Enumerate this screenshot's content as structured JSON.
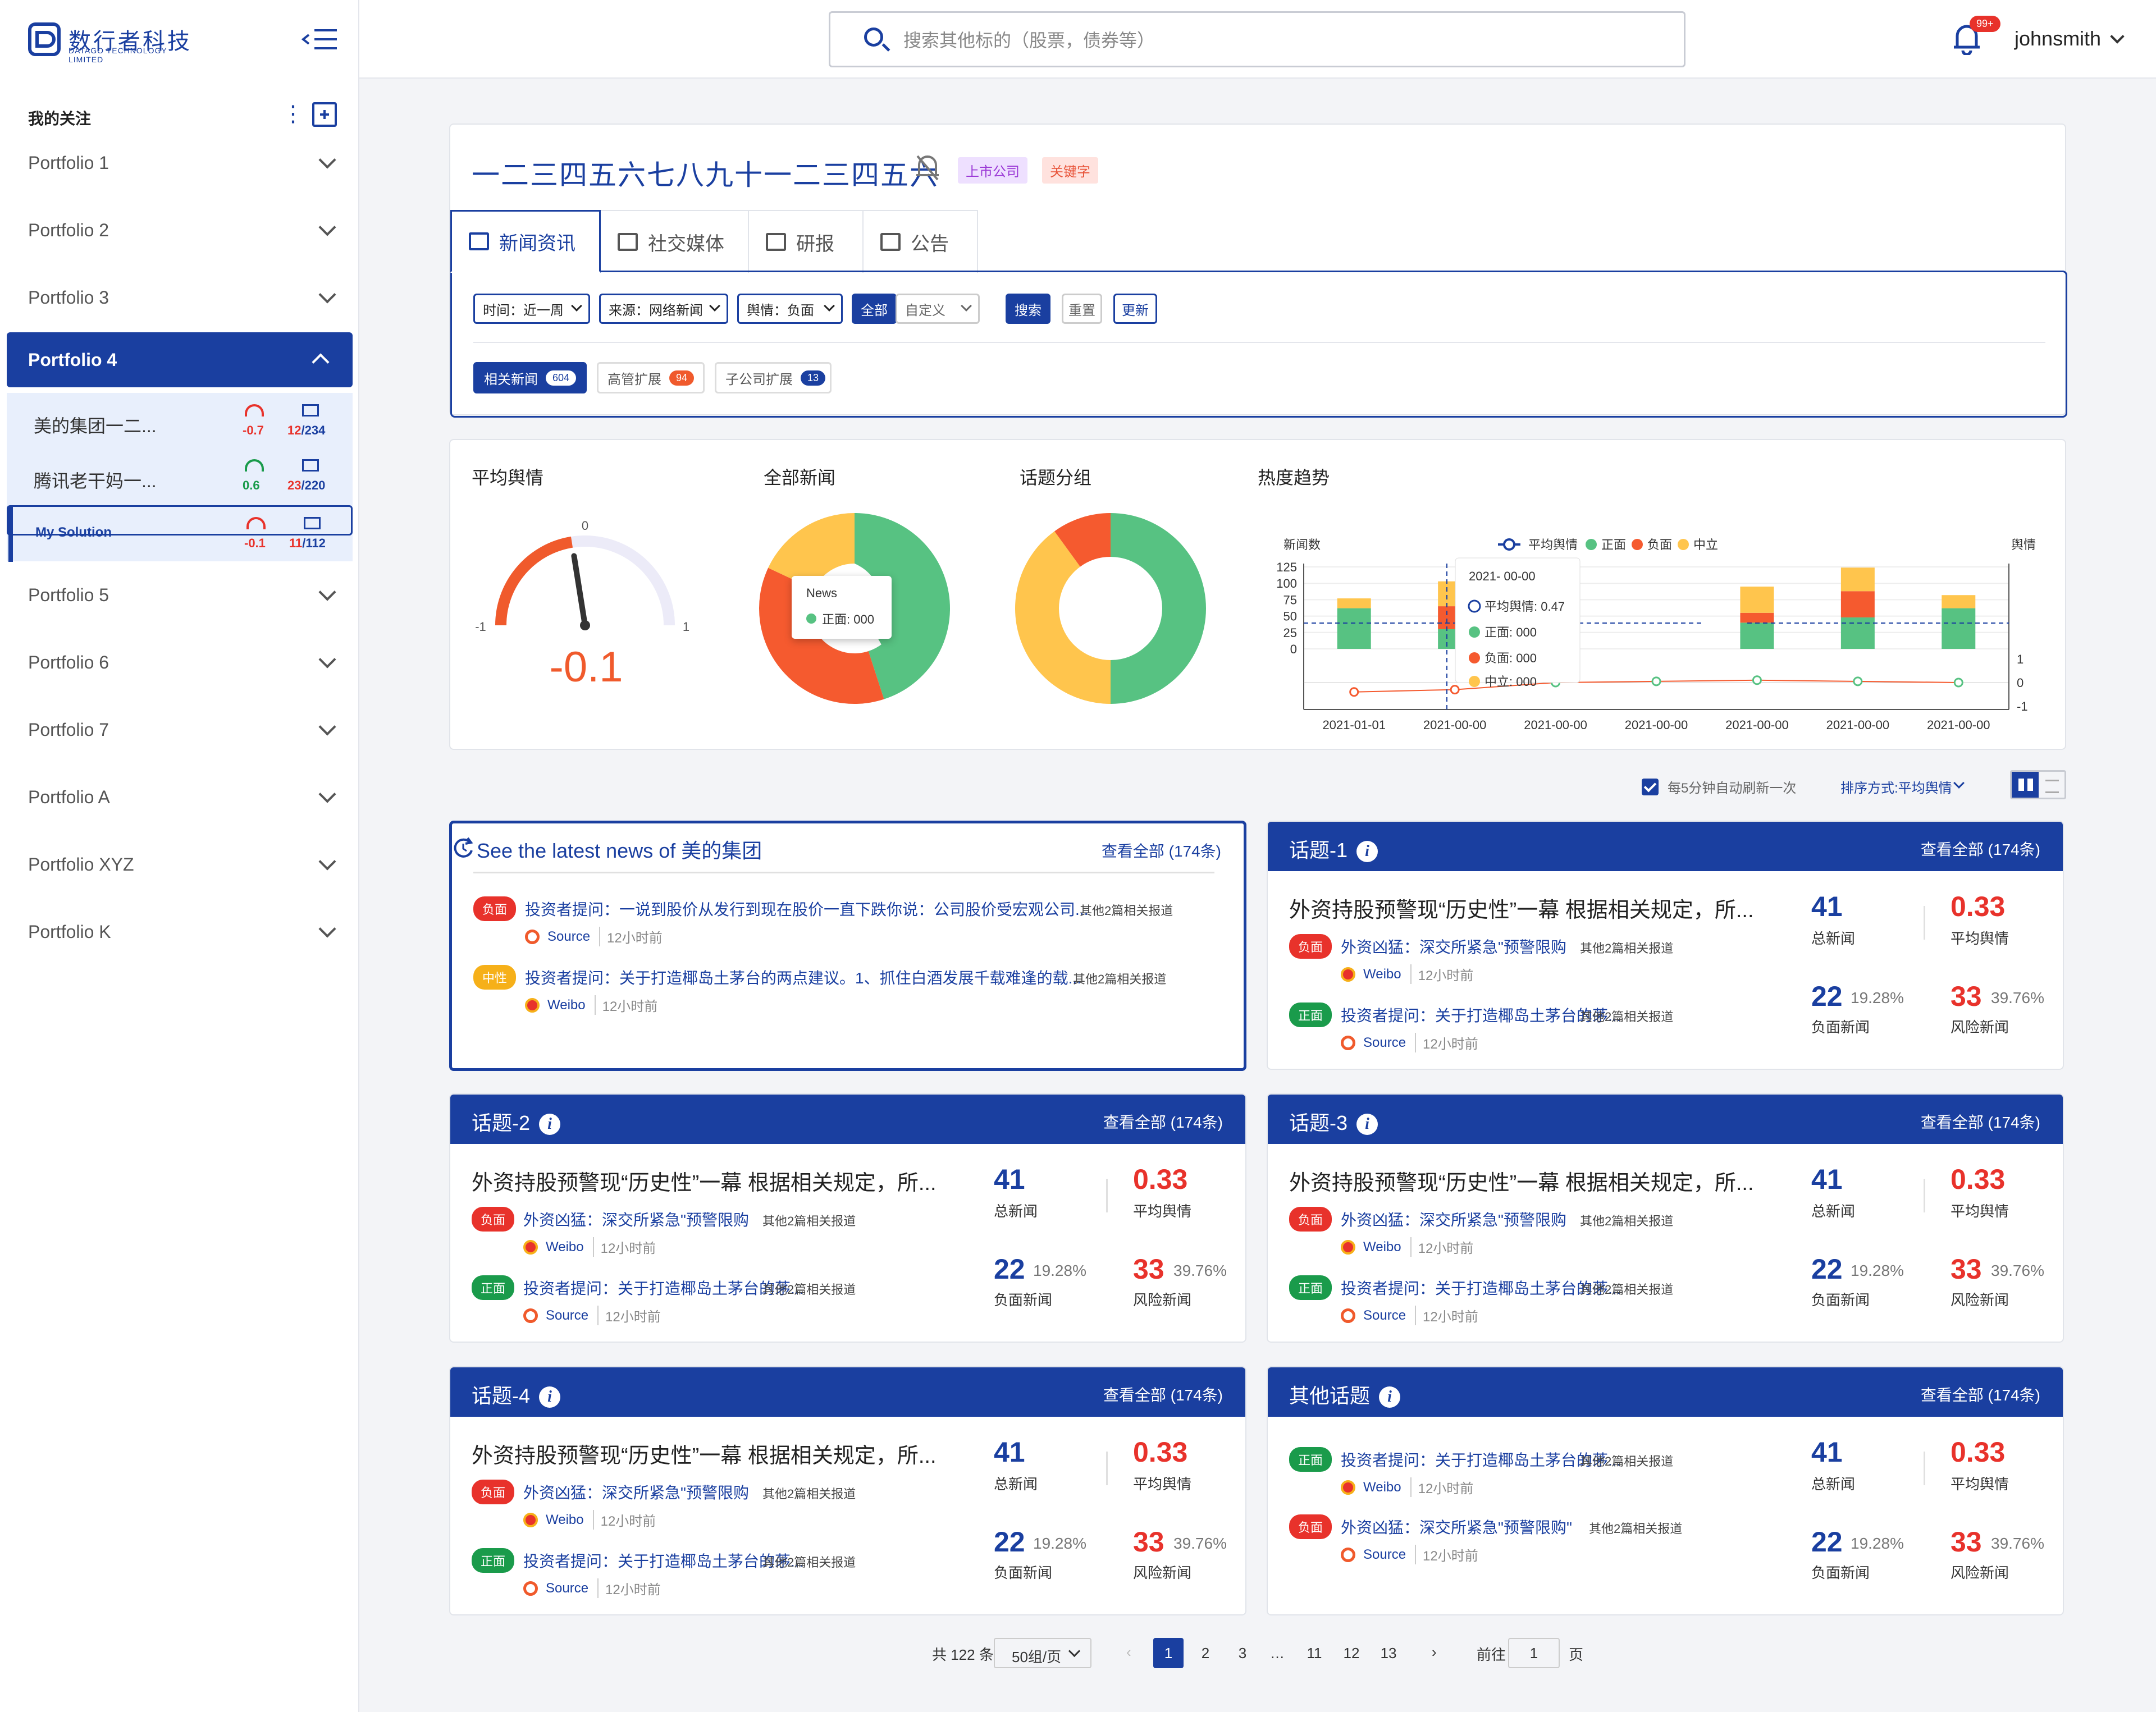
{
  "app": {
    "logo_cn": "数行者科技",
    "logo_en": "DATAGO TECHNOLOGY LIMITED"
  },
  "search": {
    "placeholder": "搜索其他标的（股票，债券等）"
  },
  "user": {
    "name": "johnsmith",
    "notif_count": "99+"
  },
  "sidebar": {
    "section_title": "我的关注",
    "portfolios": [
      "Portfolio 1",
      "Portfolio 2",
      "Portfolio 3",
      "Portfolio 4",
      "Portfolio 5",
      "Portfolio 6",
      "Portfolio 7",
      "Portfolio A",
      "Portfolio XYZ",
      "Portfolio K"
    ],
    "sub_items": [
      {
        "name": "美的集团一二...",
        "sentiment": "-0.7",
        "news_count": "12",
        "news_total": "/234"
      },
      {
        "name": "腾讯老干妈一...",
        "sentiment": "0.6",
        "news_count": "23",
        "news_total": "/220"
      },
      {
        "name": "My Solution",
        "sentiment": "-0.1",
        "news_count": "11",
        "news_total": "/112"
      }
    ]
  },
  "company": {
    "name": "一二三四五六七八九十一二三四五六",
    "tag_listed": "上市公司",
    "tag_keyword": "关键字"
  },
  "tabs": [
    "新闻资讯",
    "社交媒体",
    "研报",
    "公告"
  ],
  "filters": {
    "time": "时间：近一周",
    "source": "来源：网络新闻",
    "sentiment": "舆情：负面",
    "all_label": "全部",
    "custom_label": "自定义",
    "search_btn": "搜索",
    "reset_btn": "重置",
    "update_btn": "更新"
  },
  "chips": [
    {
      "label": "相关新闻",
      "count": "604"
    },
    {
      "label": "高管扩展",
      "count": "94"
    },
    {
      "label": "子公司扩展",
      "count": "13"
    }
  ],
  "charts": {
    "avg_sentiment": {
      "title": "平均舆情",
      "min": "-1",
      "max": "1",
      "mid": "0",
      "value": "-0.1"
    },
    "all_news": {
      "title": "全部新闻",
      "tooltip_title": "News",
      "tooltip_value": "正面: 000"
    },
    "topic_group": {
      "title": "话题分组"
    },
    "trend": {
      "title": "热度趋势",
      "y_left_label": "新闻数",
      "y_right_label": "舆情",
      "legend": [
        "平均舆情",
        "正面",
        "负面",
        "中立"
      ],
      "y_left_ticks": [
        "125",
        "100",
        "75",
        "50",
        "25",
        "0"
      ],
      "y_right_ticks": [
        "1",
        "0",
        "-1"
      ],
      "tooltip": {
        "date": "2021- 00-00",
        "avg": "平均舆情: 0.47",
        "pos": "正面: 000",
        "neg": "负面: 000",
        "neu": "中立: 000"
      }
    }
  },
  "colors": {
    "primary": "#1a3fa0",
    "positive": "#57c282",
    "negative": "#f55a2f",
    "neutral": "#ffc54d",
    "gauge_red": "#f05a2c"
  },
  "chart_data": [
    {
      "type": "gauge",
      "title": "平均舆情",
      "value": -0.1,
      "range": [
        -1,
        1
      ]
    },
    {
      "type": "pie",
      "title": "全部新闻",
      "labels": [
        "正面",
        "负面",
        "中立"
      ],
      "values": [
        45,
        37,
        18
      ]
    },
    {
      "type": "pie",
      "title": "话题分组",
      "labels": [
        "正面",
        "中立",
        "负面"
      ],
      "values": [
        50,
        40,
        10
      ]
    },
    {
      "type": "bar",
      "title": "热度趋势",
      "categories": [
        "2021-01-01",
        "2021-00-00",
        "2021-00-00",
        "2021-00-00",
        "2021-00-00",
        "2021-00-00",
        "2021-00-00"
      ],
      "series": [
        {
          "name": "正面",
          "values": [
            62,
            30,
            75,
            0,
            40,
            48,
            62
          ]
        },
        {
          "name": "负面",
          "values": [
            0,
            35,
            8,
            0,
            15,
            40,
            0
          ]
        },
        {
          "name": "中立",
          "values": [
            15,
            38,
            30,
            0,
            40,
            36,
            20
          ]
        },
        {
          "name": "平均舆情",
          "values": [
            -0.4,
            -0.3,
            0.0,
            0.05,
            0.1,
            0.05,
            0.0
          ]
        }
      ],
      "ylim": [
        0,
        125
      ],
      "y2lim": [
        -1,
        1
      ],
      "ylabel": "新闻数",
      "y2label": "舆情"
    }
  ],
  "toolbar": {
    "auto_refresh": "每5分钟自动刷新一次",
    "sort": "排序方式:平均舆情"
  },
  "latest": {
    "title": "See the latest news of 美的集团",
    "view_all": "查看全部 (174条)",
    "items": [
      {
        "badge": "负面",
        "type": "neg",
        "text": "投资者提问：一说到股价从发行到现在股价一直下跌你说：公司股价受宏观公司...",
        "other": "其他2篇相关报道",
        "src": "Source",
        "time": "12小时前",
        "icon": "sr"
      },
      {
        "badge": "中性",
        "type": "neu",
        "text": "投资者提问：关于打造椰岛土茅台的两点建议。1、抓住白酒发展千载难逢的载...",
        "other": "其他2篇相关报道",
        "src": "Weibo",
        "time": "12小时前",
        "icon": "wb"
      }
    ]
  },
  "topics": [
    {
      "title": "话题-1",
      "view_all": "查看全部 (174条)",
      "headline": "外资持股预警现“历史性”一幕 根据相关规定，所...",
      "news": [
        {
          "badge": "负面",
          "type": "neg",
          "text": "外资凶猛：深交所紧急\"预警限购",
          "other": "其他2篇相关报道",
          "src": "Weibo",
          "time": "12小时前",
          "icon": "wb"
        },
        {
          "badge": "正面",
          "type": "pos",
          "text": "投资者提问：关于打造椰岛土茅台的茅...",
          "other": "其他2篇相关报道",
          "src": "Source",
          "time": "12小时前",
          "icon": "sr"
        }
      ],
      "total": "41",
      "total_label": "总新闻",
      "avg": "0.33",
      "avg_label": "平均舆情",
      "neg": "22",
      "neg_pct": "19.28%",
      "neg_label": "负面新闻",
      "risk": "33",
      "risk_pct": "39.76%",
      "risk_label": "风险新闻"
    },
    {
      "title": "话题-2",
      "view_all": "查看全部 (174条)",
      "headline": "外资持股预警现“历史性”一幕 根据相关规定，所...",
      "news": [
        {
          "badge": "负面",
          "type": "neg",
          "text": "外资凶猛：深交所紧急\"预警限购",
          "other": "其他2篇相关报道",
          "src": "Weibo",
          "time": "12小时前",
          "icon": "wb"
        },
        {
          "badge": "正面",
          "type": "pos",
          "text": "投资者提问：关于打造椰岛土茅台的茅...",
          "other": "其他2篇相关报道",
          "src": "Source",
          "time": "12小时前",
          "icon": "sr"
        }
      ],
      "total": "41",
      "total_label": "总新闻",
      "avg": "0.33",
      "avg_label": "平均舆情",
      "neg": "22",
      "neg_pct": "19.28%",
      "neg_label": "负面新闻",
      "risk": "33",
      "risk_pct": "39.76%",
      "risk_label": "风险新闻"
    },
    {
      "title": "话题-3",
      "view_all": "查看全部 (174条)",
      "headline": "外资持股预警现“历史性”一幕 根据相关规定，所...",
      "news": [
        {
          "badge": "负面",
          "type": "neg",
          "text": "外资凶猛：深交所紧急\"预警限购",
          "other": "其他2篇相关报道",
          "src": "Weibo",
          "time": "12小时前",
          "icon": "wb"
        },
        {
          "badge": "正面",
          "type": "pos",
          "text": "投资者提问：关于打造椰岛土茅台的茅...",
          "other": "其他2篇相关报道",
          "src": "Source",
          "time": "12小时前",
          "icon": "sr"
        }
      ],
      "total": "41",
      "total_label": "总新闻",
      "avg": "0.33",
      "avg_label": "平均舆情",
      "neg": "22",
      "neg_pct": "19.28%",
      "neg_label": "负面新闻",
      "risk": "33",
      "risk_pct": "39.76%",
      "risk_label": "风险新闻"
    },
    {
      "title": "话题-4",
      "view_all": "查看全部 (174条)",
      "headline": "外资持股预警现“历史性”一幕 根据相关规定，所...",
      "news": [
        {
          "badge": "负面",
          "type": "neg",
          "text": "外资凶猛：深交所紧急\"预警限购",
          "other": "其他2篇相关报道",
          "src": "Weibo",
          "time": "12小时前",
          "icon": "wb"
        },
        {
          "badge": "正面",
          "type": "pos",
          "text": "投资者提问：关于打造椰岛土茅台的茅...",
          "other": "其他2篇相关报道",
          "src": "Source",
          "time": "12小时前",
          "icon": "sr"
        }
      ],
      "total": "41",
      "total_label": "总新闻",
      "avg": "0.33",
      "avg_label": "平均舆情",
      "neg": "22",
      "neg_pct": "19.28%",
      "neg_label": "负面新闻",
      "risk": "33",
      "risk_pct": "39.76%",
      "risk_label": "风险新闻"
    },
    {
      "title": "其他话题",
      "view_all": "查看全部 (174条)",
      "headline": "",
      "news": [
        {
          "badge": "正面",
          "type": "pos",
          "text": "投资者提问：关于打造椰岛土茅台的茅...",
          "other": "其他2篇相关报道",
          "src": "Weibo",
          "time": "12小时前",
          "icon": "wb"
        },
        {
          "badge": "负面",
          "type": "neg",
          "text": "外资凶猛：深交所紧急\"预警限购\"",
          "other": "其他2篇相关报道",
          "src": "Source",
          "time": "12小时前",
          "icon": "sr"
        }
      ],
      "total": "41",
      "total_label": "总新闻",
      "avg": "0.33",
      "avg_label": "平均舆情",
      "neg": "22",
      "neg_pct": "19.28%",
      "neg_label": "负面新闻",
      "risk": "33",
      "risk_pct": "39.76%",
      "risk_label": "风险新闻"
    }
  ],
  "pagination": {
    "total": "共 122 条",
    "page_size": "50组/页",
    "pages": [
      "1",
      "2",
      "3",
      "…",
      "11",
      "12",
      "13"
    ],
    "current": "1",
    "goto_label": "前往",
    "goto_value": "1",
    "page_suffix": "页"
  }
}
